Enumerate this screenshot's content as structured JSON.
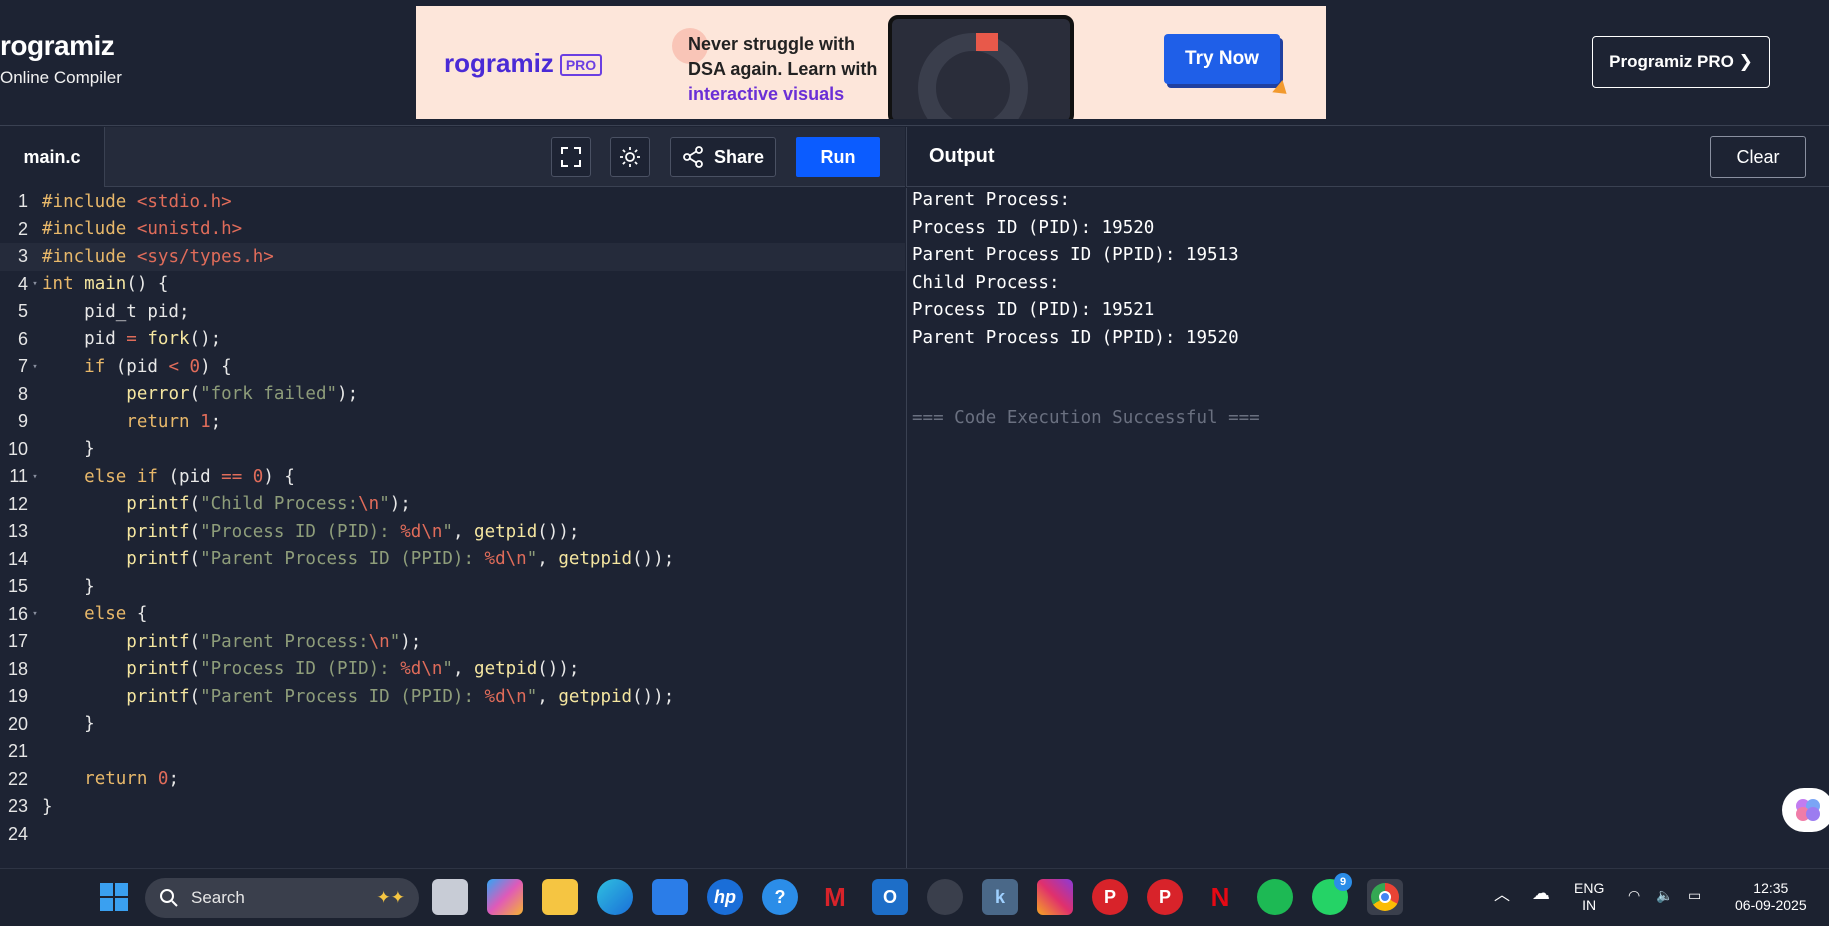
{
  "header": {
    "logo_name": "rogramiz",
    "logo_sub": "Online Compiler",
    "pro_button": "Programiz PRO ❯"
  },
  "ad": {
    "logo": "rogramiz",
    "pro_tag": "PRO",
    "line1": "Never struggle with",
    "line2": "DSA again. Learn with",
    "line3": "interactive visuals",
    "cta": "Try Now"
  },
  "toolbar": {
    "file_tab": "main.c",
    "share_label": "Share",
    "run_label": "Run"
  },
  "output_panel": {
    "title": "Output",
    "clear_label": "Clear",
    "lines": [
      "Parent Process:",
      "Process ID (PID): 19520",
      "Parent Process ID (PPID): 19513",
      "Child Process:",
      "Process ID (PID): 19521",
      "Parent Process ID (PPID): 19520"
    ],
    "status": "=== Code Execution Successful ==="
  },
  "editor": {
    "active_line": 3,
    "lines": [
      "#include <stdio.h>",
      "#include <unistd.h>",
      "#include <sys/types.h>",
      "int main() {",
      "    pid_t pid;",
      "    pid = fork();",
      "    if (pid < 0) {",
      "        perror(\"fork failed\");",
      "        return 1;",
      "    }",
      "    else if (pid == 0) {",
      "        printf(\"Child Process:\\n\");",
      "        printf(\"Process ID (PID): %d\\n\", getpid());",
      "        printf(\"Parent Process ID (PPID): %d\\n\", getppid());",
      "    }",
      "    else {",
      "        printf(\"Parent Process:\\n\");",
      "        printf(\"Process ID (PID): %d\\n\", getpid());",
      "        printf(\"Parent Process ID (PPID): %d\\n\", getppid());",
      "    }",
      "",
      "    return 0;",
      "}",
      ""
    ],
    "fold_lines": [
      4,
      7,
      11,
      16
    ]
  },
  "taskbar": {
    "search_placeholder": "Search",
    "whatsapp_badge": "9",
    "lang_line1": "ENG",
    "lang_line2": "IN",
    "time": "12:35",
    "date": "06-09-2025"
  }
}
